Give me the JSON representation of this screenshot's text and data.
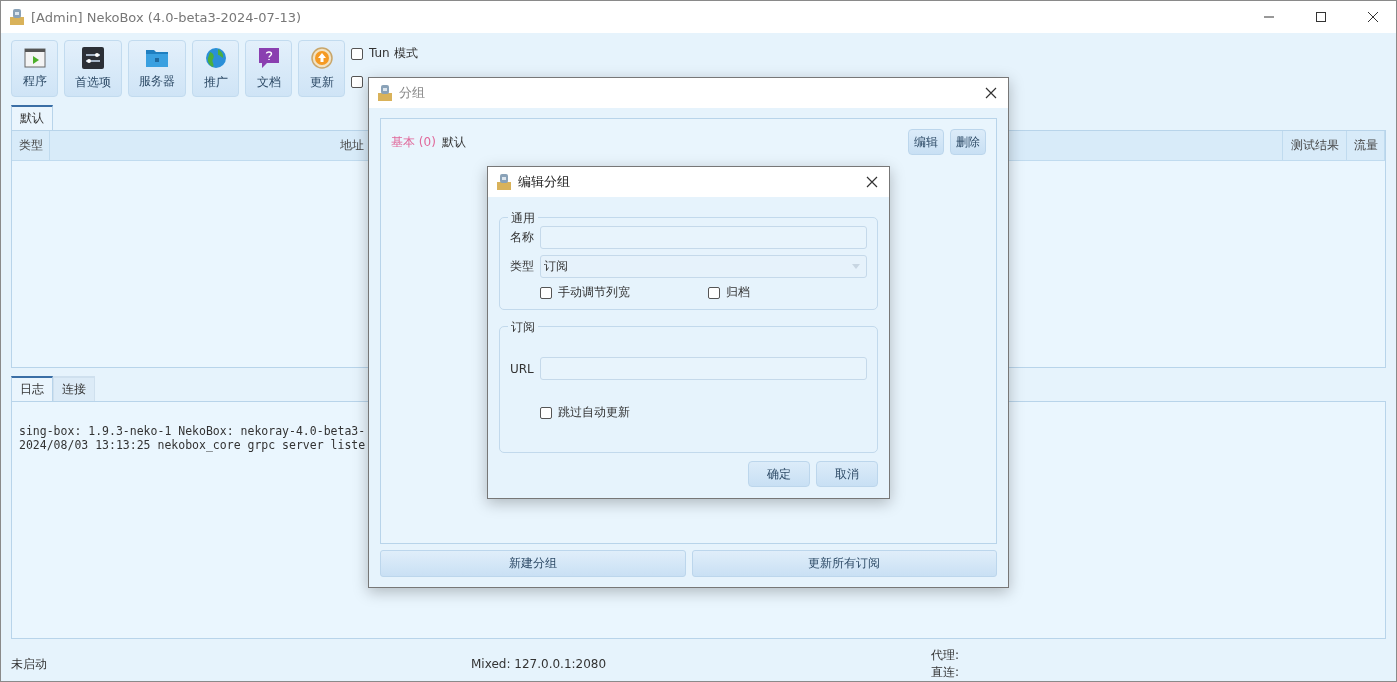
{
  "window": {
    "title": "[Admin] NekoBox (4.0-beta3-2024-07-13)"
  },
  "toolbar": [
    {
      "label": "程序",
      "kind": "program"
    },
    {
      "label": "首选项",
      "kind": "prefs"
    },
    {
      "label": "服务器",
      "kind": "server"
    },
    {
      "label": "推广",
      "kind": "globe"
    },
    {
      "label": "文档",
      "kind": "docs"
    },
    {
      "label": "更新",
      "kind": "update"
    }
  ],
  "toolbar_checks": [
    {
      "label": "Tun 模式",
      "checked": false
    },
    {
      "checked": false
    }
  ],
  "group_tabs": [
    {
      "label": "默认",
      "selected": true
    }
  ],
  "table": {
    "columns": [
      "类型",
      "地址",
      "测试结果",
      "流量"
    ]
  },
  "bottom_tabs": [
    {
      "label": "日志",
      "selected": true
    },
    {
      "label": "连接",
      "selected": false
    }
  ],
  "log_lines": [
    "sing-box: 1.9.3-neko-1 NekoBox: nekoray-4.0-beta3-",
    "2024/08/03 13:13:25 nekobox_core grpc server liste"
  ],
  "status_bar": {
    "state": "未启动",
    "mixed": "Mixed: 127.0.0.1:2080",
    "proxy": "代理:",
    "direct": "直连:"
  },
  "group_dialog": {
    "title": "分组",
    "groups": [
      {
        "type": "基本 (0)",
        "name": "默认",
        "buttons": [
          "编辑",
          "删除"
        ]
      }
    ],
    "buttons": [
      "新建分组",
      "更新所有订阅"
    ]
  },
  "edit_dialog": {
    "title": "编辑分组",
    "general": {
      "title": "通用",
      "name_label": "名称",
      "type_label": "类型",
      "type_value": "订阅",
      "checks": [
        {
          "label": "手动调节列宽",
          "checked": false
        },
        {
          "label": "归档",
          "checked": false
        }
      ]
    },
    "subscription": {
      "title": "订阅",
      "url_label": "URL",
      "checks": [
        {
          "label": "跳过自动更新",
          "checked": false
        }
      ]
    },
    "buttons": [
      "确定",
      "取消"
    ]
  }
}
